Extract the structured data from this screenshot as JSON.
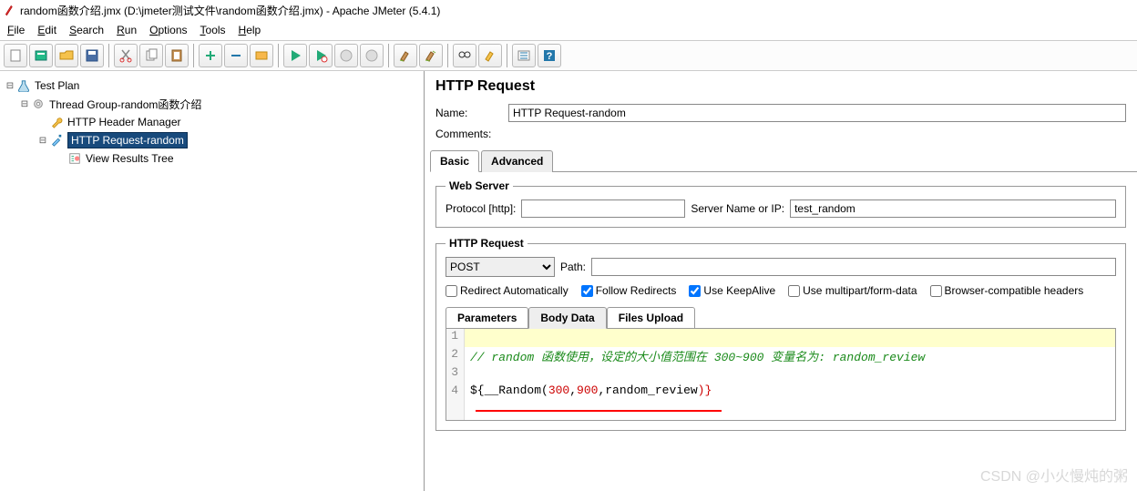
{
  "window": {
    "title": "random函数介绍.jmx (D:\\jmeter测试文件\\random函数介绍.jmx) - Apache JMeter (5.4.1)"
  },
  "menu": {
    "file": "File",
    "edit": "Edit",
    "search": "Search",
    "run": "Run",
    "options": "Options",
    "tools": "Tools",
    "help": "Help"
  },
  "tree": {
    "plan": "Test Plan",
    "group": "Thread Group-random函数介绍",
    "hdrmgr": "HTTP Header Manager",
    "req": "HTTP Request-random",
    "results": "View Results Tree"
  },
  "http": {
    "heading": "HTTP Request",
    "name_label": "Name:",
    "name_value": "HTTP Request-random",
    "comments_label": "Comments:",
    "tab_basic": "Basic",
    "tab_advanced": "Advanced",
    "web_server_legend": "Web Server",
    "protocol_label": "Protocol [http]:",
    "protocol_value": "",
    "server_label": "Server Name or IP:",
    "server_value": "test_random",
    "req_legend": "HTTP Request",
    "method": "POST",
    "path_label": "Path:",
    "path_value": "",
    "cb_redirect_auto": "Redirect Automatically",
    "cb_follow": "Follow Redirects",
    "cb_keepalive": "Use KeepAlive",
    "cb_multipart": "Use multipart/form-data",
    "cb_browser": "Browser-compatible headers",
    "sub_params": "Parameters",
    "sub_body": "Body Data",
    "sub_files": "Files Upload",
    "body": {
      "l1": "",
      "l2": "// random 函数使用，设定的大小值范围在 300~900 变量名为: random_review",
      "l3": "",
      "l4_a": "${",
      "l4_b": "__Random(",
      "l4_c": "300",
      "l4_d": ",",
      "l4_e": "900",
      "l4_f": ",random_review",
      "l4_g": ")}"
    }
  },
  "watermark": "CSDN @小火慢炖的粥"
}
